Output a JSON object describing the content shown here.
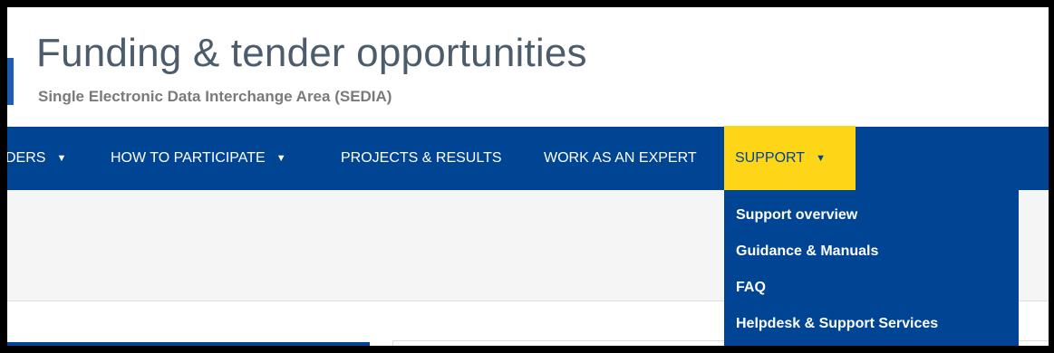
{
  "header": {
    "title": "Funding & tender opportunities",
    "subtitle": "Single Electronic Data Interchange Area (SEDIA)"
  },
  "nav": {
    "items": [
      {
        "label": "DERS",
        "caret": "▼"
      },
      {
        "label": "HOW TO PARTICIPATE",
        "caret": "▼"
      },
      {
        "label": "PROJECTS & RESULTS"
      },
      {
        "label": "WORK AS AN EXPERT"
      },
      {
        "label": "SUPPORT",
        "caret": "▼",
        "active": true
      }
    ]
  },
  "support_menu": {
    "items": [
      "Support overview",
      "Guidance & Manuals",
      "FAQ",
      "Helpdesk & Support Services"
    ]
  },
  "colors": {
    "nav_bg": "#004494",
    "active_bg": "#ffd617",
    "title": "#4c5c6c"
  }
}
